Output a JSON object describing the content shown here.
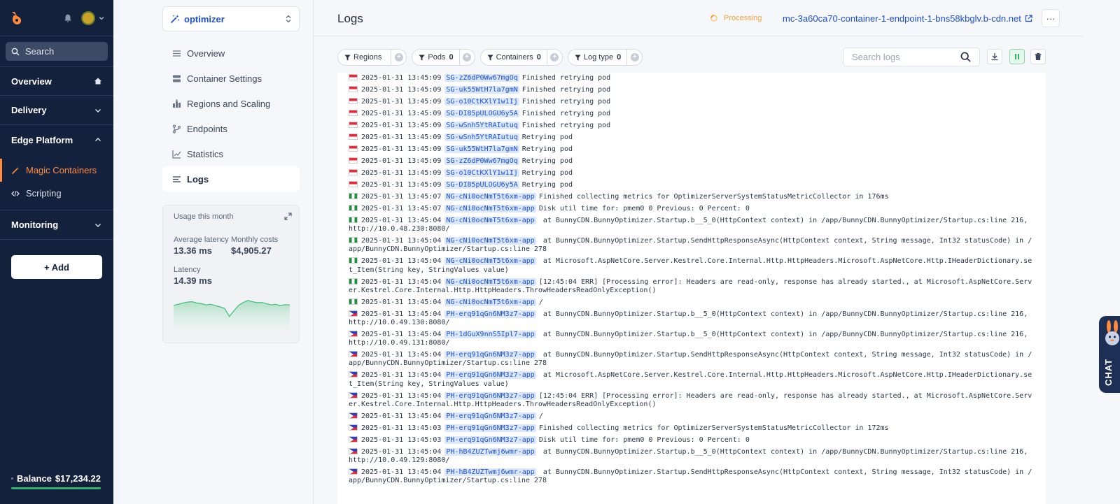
{
  "sidebar": {
    "search_label": "Search",
    "sections": [
      {
        "label": "Overview"
      },
      {
        "label": "Delivery"
      },
      {
        "label": "Edge Platform"
      },
      {
        "label": "Monitoring"
      }
    ],
    "edge_items": [
      {
        "label": "Magic Containers"
      },
      {
        "label": "Scripting"
      }
    ],
    "add_label": "+ Add",
    "balance_label": "Balance",
    "balance_amount": "$17,234.22"
  },
  "project": {
    "name": "optimizer",
    "menu": [
      {
        "label": "Overview"
      },
      {
        "label": "Container Settings"
      },
      {
        "label": "Regions and Scaling"
      },
      {
        "label": "Endpoints"
      },
      {
        "label": "Statistics"
      },
      {
        "label": "Logs"
      }
    ],
    "usage": {
      "title": "Usage this month",
      "avg_latency_label": "Average latency",
      "avg_latency": "13.36 ms",
      "monthly_costs_label": "Monthly costs",
      "monthly_costs": "$4,905.27",
      "latency_label": "Latency",
      "latency": "14.39 ms",
      "sparkline": [
        0.55,
        0.58,
        0.62,
        0.65,
        0.66,
        0.62,
        0.6,
        0.56,
        0.58,
        0.54,
        0.5,
        0.45,
        0.2,
        0.38,
        0.55,
        0.64,
        0.7,
        0.66,
        0.63,
        0.64,
        0.6,
        0.56,
        0.58,
        0.54,
        0.57,
        0.56
      ]
    }
  },
  "header": {
    "title": "Logs",
    "status": "Processing",
    "endpoint": "mc-3a60ca70-container-1-endpoint-1-bns58kbglv.b-cdn.net",
    "more_label": "···"
  },
  "filters": [
    {
      "label": "Regions",
      "count": ""
    },
    {
      "label": "Pods",
      "count": "0"
    },
    {
      "label": "Containers",
      "count": "0"
    },
    {
      "label": "Log type",
      "count": "0"
    }
  ],
  "log_search_placeholder": "Search logs",
  "colors": {
    "sidebar_bg": "#14213d",
    "accent": "#ff8a3d",
    "link": "#1c4fd6",
    "processing": "#f0a23b",
    "balance_bar": "#2fb36d"
  },
  "logs": [
    {
      "flag": "sg",
      "ts": "2025-01-31 13:45:09",
      "pod": "SG-zZ6dP0Ww67mgOq",
      "msg": "Finished retrying pod"
    },
    {
      "flag": "sg",
      "ts": "2025-01-31 13:45:09",
      "pod": "SG-uk55WtH7la7gmN",
      "msg": "Finished retrying pod"
    },
    {
      "flag": "sg",
      "ts": "2025-01-31 13:45:09",
      "pod": "SG-o10CtKXlY1w1Ij",
      "msg": "Finished retrying pod"
    },
    {
      "flag": "sg",
      "ts": "2025-01-31 13:45:09",
      "pod": "SG-DI85pULOGU6y5A",
      "msg": "Finished retrying pod"
    },
    {
      "flag": "sg",
      "ts": "2025-01-31 13:45:09",
      "pod": "SG-wSnh5YtRAIutuq",
      "msg": "Finished retrying pod"
    },
    {
      "flag": "sg",
      "ts": "2025-01-31 13:45:09",
      "pod": "SG-wSnh5YtRAIutuq",
      "msg": "Retrying pod"
    },
    {
      "flag": "sg",
      "ts": "2025-01-31 13:45:09",
      "pod": "SG-uk55WtH7la7gmN",
      "msg": "Retrying pod"
    },
    {
      "flag": "sg",
      "ts": "2025-01-31 13:45:09",
      "pod": "SG-zZ6dP0Ww67mgOq",
      "msg": "Retrying pod"
    },
    {
      "flag": "sg",
      "ts": "2025-01-31 13:45:09",
      "pod": "SG-o10CtKXlY1w1Ij",
      "msg": "Retrying pod"
    },
    {
      "flag": "sg",
      "ts": "2025-01-31 13:45:09",
      "pod": "SG-DI85pULOGU6y5A",
      "msg": "Retrying pod"
    },
    {
      "flag": "ng",
      "ts": "2025-01-31 13:45:07",
      "pod": "NG-cNi0ocNmT5t6xm-app",
      "msg": "Finished collecting metrics for OptimizerServerSystemStatusMetricCollector in 176ms"
    },
    {
      "flag": "ng",
      "ts": "2025-01-31 13:45:07",
      "pod": "NG-cNi0ocNmT5t6xm-app",
      "msg": "Disk util time for: pmem0 0 Previous: 0 Percent: 0"
    },
    {
      "flag": "ng",
      "ts": "2025-01-31 13:45:04",
      "pod": "NG-cNi0ocNmT5t6xm-app",
      "msg": " at BunnyCDN.BunnyOptimizer.Startup.b__5_0(HttpContext context) in /app/BunnyCDN.BunnyOptimizer/Startup.cs:line 216, http://10.0.48.230:8080/"
    },
    {
      "flag": "ng",
      "ts": "2025-01-31 13:45:04",
      "pod": "NG-cNi0ocNmT5t6xm-app",
      "msg": " at BunnyCDN.BunnyOptimizer.Startup.SendHttpResponseAsync(HttpContext context, String message, Int32 statusCode) in /app/BunnyCDN.BunnyOptimizer/Startup.cs:line 278"
    },
    {
      "flag": "ng",
      "ts": "2025-01-31 13:45:04",
      "pod": "NG-cNi0ocNmT5t6xm-app",
      "msg": " at Microsoft.AspNetCore.Server.Kestrel.Core.Internal.Http.HttpHeaders.Microsoft.AspNetCore.Http.IHeaderDictionary.set_Item(String key, StringValues value)"
    },
    {
      "flag": "ng",
      "ts": "2025-01-31 13:45:04",
      "pod": "NG-cNi0ocNmT5t6xm-app",
      "msg": "[12:45:04 ERR] [Processing error]: Headers are read-only, response has already started., at Microsoft.AspNetCore.Server.Kestrel.Core.Internal.Http.HttpHeaders.ThrowHeadersReadOnlyException()"
    },
    {
      "flag": "ng",
      "ts": "2025-01-31 13:45:04",
      "pod": "NG-cNi0ocNmT5t6xm-app",
      "msg": "/"
    },
    {
      "flag": "ph",
      "ts": "2025-01-31 13:45:04",
      "pod": "PH-erq91qGn6NM3z7-app",
      "msg": " at BunnyCDN.BunnyOptimizer.Startup.b__5_0(HttpContext context) in /app/BunnyCDN.BunnyOptimizer/Startup.cs:line 216, http://10.0.49.130:8080/"
    },
    {
      "flag": "ph",
      "ts": "2025-01-31 13:45:04",
      "pod": "PH-1dGuX9nnS5Ipl7-app",
      "msg": " at BunnyCDN.BunnyOptimizer.Startup.b__5_0(HttpContext context) in /app/BunnyCDN.BunnyOptimizer/Startup.cs:line 216, http://10.0.49.131:8080/"
    },
    {
      "flag": "ph",
      "ts": "2025-01-31 13:45:04",
      "pod": "PH-erq91qGn6NM3z7-app",
      "msg": " at BunnyCDN.BunnyOptimizer.Startup.SendHttpResponseAsync(HttpContext context, String message, Int32 statusCode) in /app/BunnyCDN.BunnyOptimizer/Startup.cs:line 278"
    },
    {
      "flag": "ph",
      "ts": "2025-01-31 13:45:04",
      "pod": "PH-erq91qGn6NM3z7-app",
      "msg": " at Microsoft.AspNetCore.Server.Kestrel.Core.Internal.Http.HttpHeaders.Microsoft.AspNetCore.Http.IHeaderDictionary.set_Item(String key, StringValues value)"
    },
    {
      "flag": "ph",
      "ts": "2025-01-31 13:45:04",
      "pod": "PH-erq91qGn6NM3z7-app",
      "msg": "[12:45:04 ERR] [Processing error]: Headers are read-only, response has already started., at Microsoft.AspNetCore.Server.Kestrel.Core.Internal.Http.HttpHeaders.ThrowHeadersReadOnlyException()"
    },
    {
      "flag": "ph",
      "ts": "2025-01-31 13:45:04",
      "pod": "PH-erq91qGn6NM3z7-app",
      "msg": "/"
    },
    {
      "flag": "ph",
      "ts": "2025-01-31 13:45:03",
      "pod": "PH-erq91qGn6NM3z7-app",
      "msg": "Finished collecting metrics for OptimizerServerSystemStatusMetricCollector in 172ms"
    },
    {
      "flag": "ph",
      "ts": "2025-01-31 13:45:03",
      "pod": "PH-erq91qGn6NM3z7-app",
      "msg": "Disk util time for: pmem0 0 Previous: 0 Percent: 0"
    },
    {
      "flag": "ph",
      "ts": "2025-01-31 13:45:04",
      "pod": "PH-hB4ZUZTwmj6wmr-app",
      "msg": " at BunnyCDN.BunnyOptimizer.Startup.b__5_0(HttpContext context) in /app/BunnyCDN.BunnyOptimizer/Startup.cs:line 216, http://10.0.49.129:8080/"
    },
    {
      "flag": "ph",
      "ts": "2025-01-31 13:45:04",
      "pod": "PH-hB4ZUZTwmj6wmr-app",
      "msg": " at BunnyCDN.BunnyOptimizer.Startup.SendHttpResponseAsync(HttpContext context, String message, Int32 statusCode) in /app/BunnyCDN.BunnyOptimizer/Startup.cs:line 278"
    }
  ],
  "chat_label": "CHAT"
}
